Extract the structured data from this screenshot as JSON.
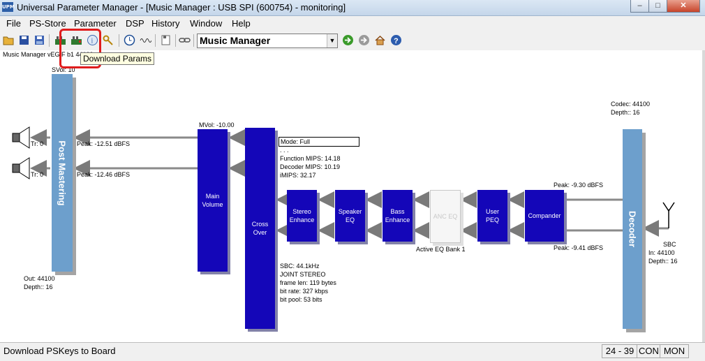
{
  "window": {
    "title": "Universal Parameter Manager - [Music Manager : USB SPI (600754) - monitoring]",
    "app_icon_text": "UPM",
    "min_glyph": "–",
    "max_glyph": "□",
    "close_glyph": "✕"
  },
  "menu": {
    "items": [
      "File",
      "PS-Store",
      "Parameter",
      "DSP",
      "History",
      "Window",
      "Help"
    ]
  },
  "toolbar": {
    "combo_value": "Music Manager",
    "combo_arrow": "▼",
    "tooltip": "Download Params",
    "icons": [
      "folder-open-icon",
      "save-icon",
      "save-all-icon",
      "upload-board-icon",
      "download-board-icon",
      "info-icon",
      "key-icon",
      "clock-icon",
      "wave-icon",
      "file-icon",
      "link-icon",
      "go-icon",
      "stop-icon",
      "home-icon",
      "help-icon"
    ]
  },
  "diagram": {
    "header_label": "Music Manager vEGIF b1 44100",
    "svol_label": "SVol: 10",
    "post_mastering": "Post Mastering",
    "tr_top": "Tr: 0",
    "tr_bottom": "Tr: 0",
    "peak_left_top": "Peak: -12.51 dBFS",
    "peak_left_bottom": "Peak: -12.46 dBFS",
    "out_line1": "Out: 44100",
    "out_line2": "Depth:: 16",
    "mvol_label": "MVol: -10.00",
    "main_volume": [
      "Main",
      "Volume"
    ],
    "cross_over": [
      "Cross",
      "Over"
    ],
    "mode": "Mode: Full",
    "dots": ". . .",
    "function_mips": "Function MIPS: 14.18",
    "decoder_mips": "Decoder MIPS: 10.19",
    "imips": "iMIPS: 32.17",
    "stereo_enhance": [
      "Stereo",
      "Enhance"
    ],
    "speaker_eq": [
      "Speaker",
      "EQ"
    ],
    "bass_enhance": [
      "Bass",
      "Enhance"
    ],
    "anc_eq": "ANC  EQ",
    "active_eq_bank": "Active EQ Bank 1",
    "user_peq": [
      "User",
      "PEQ"
    ],
    "compander": "Compander",
    "peak_right_top": "Peak: -9.30 dBFS",
    "peak_right_bottom": "Peak: -9.41 dBFS",
    "sbc_info": [
      "SBC: 44.1kHz",
      "JOINT STEREO",
      "frame len: 119 bytes",
      "bit rate: 327 kbps",
      "bit pool: 53 bits"
    ],
    "codec_line1": "Codec: 44100",
    "codec_line2": "Depth:: 16",
    "decoder": "Decoder",
    "sbc_in": [
      "SBC",
      "In: 44100",
      "Depth:: 16"
    ]
  },
  "status": {
    "text": "Download PSKeys to Board",
    "range": "24 - 39",
    "con": "CON",
    "mon": "MON"
  }
}
